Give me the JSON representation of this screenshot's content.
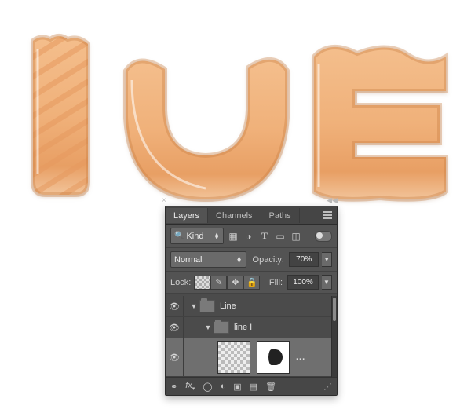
{
  "tabs": {
    "layers": "Layers",
    "channels": "Channels",
    "paths": "Paths"
  },
  "filter": {
    "label": "Kind"
  },
  "blend": {
    "mode": "Normal",
    "opacity_label": "Opacity:",
    "opacity_value": "70%"
  },
  "lock": {
    "label": "Lock:",
    "fill_label": "Fill:",
    "fill_value": "100%"
  },
  "layers": {
    "group": "Line",
    "subgroup": "line I",
    "selected_dots": "..."
  },
  "footer": {
    "fx": "fx"
  }
}
